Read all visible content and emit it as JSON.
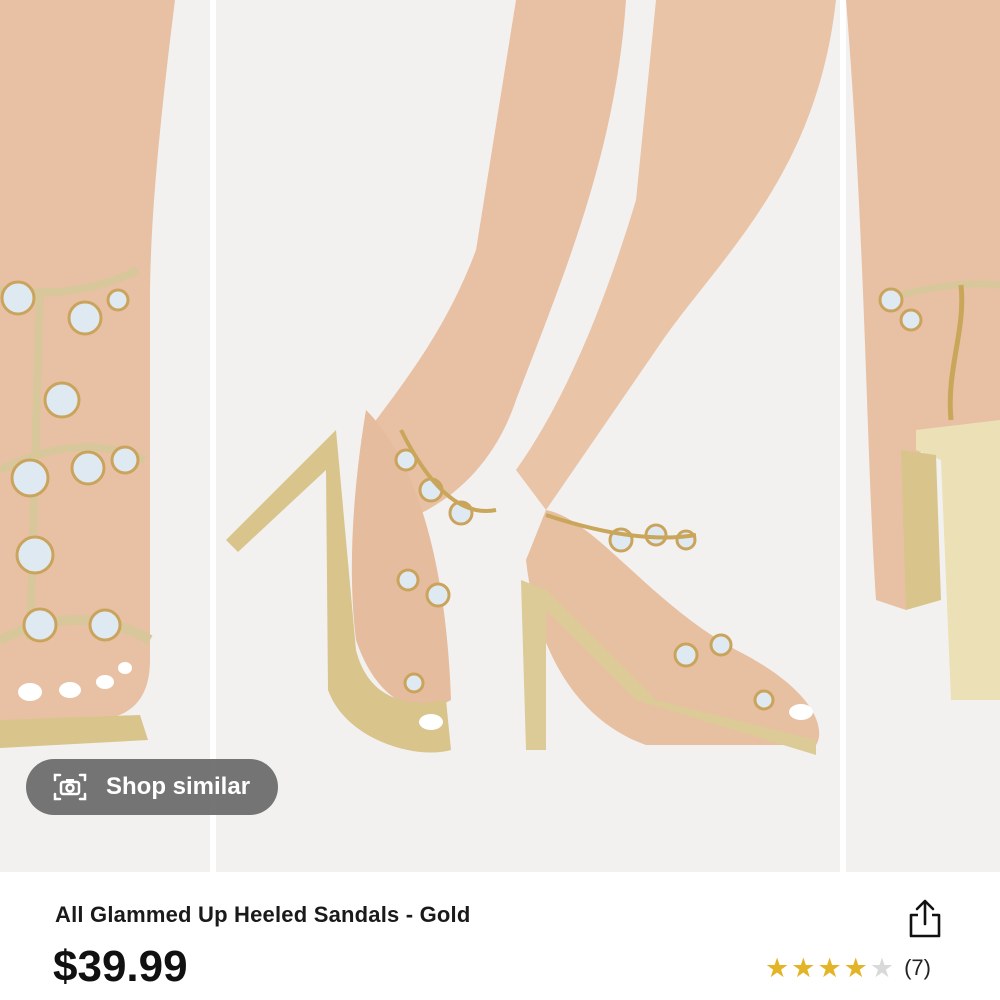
{
  "gallery": {
    "images": [
      {
        "name": "product-image-front"
      },
      {
        "name": "product-image-side"
      },
      {
        "name": "product-image-back"
      }
    ],
    "shop_similar": {
      "label": "Shop similar",
      "icon": "camera-icon"
    },
    "badge_color": "#b3202a"
  },
  "product": {
    "title": "All Glammed Up Heeled Sandals - Gold",
    "price": "$39.99",
    "rating": {
      "stars": 4,
      "max": 5,
      "count": "(7)"
    },
    "share_icon": "share-icon"
  },
  "colors": {
    "star": "#e4b427",
    "overlay": "#696969",
    "gold": "#d8c79a"
  }
}
